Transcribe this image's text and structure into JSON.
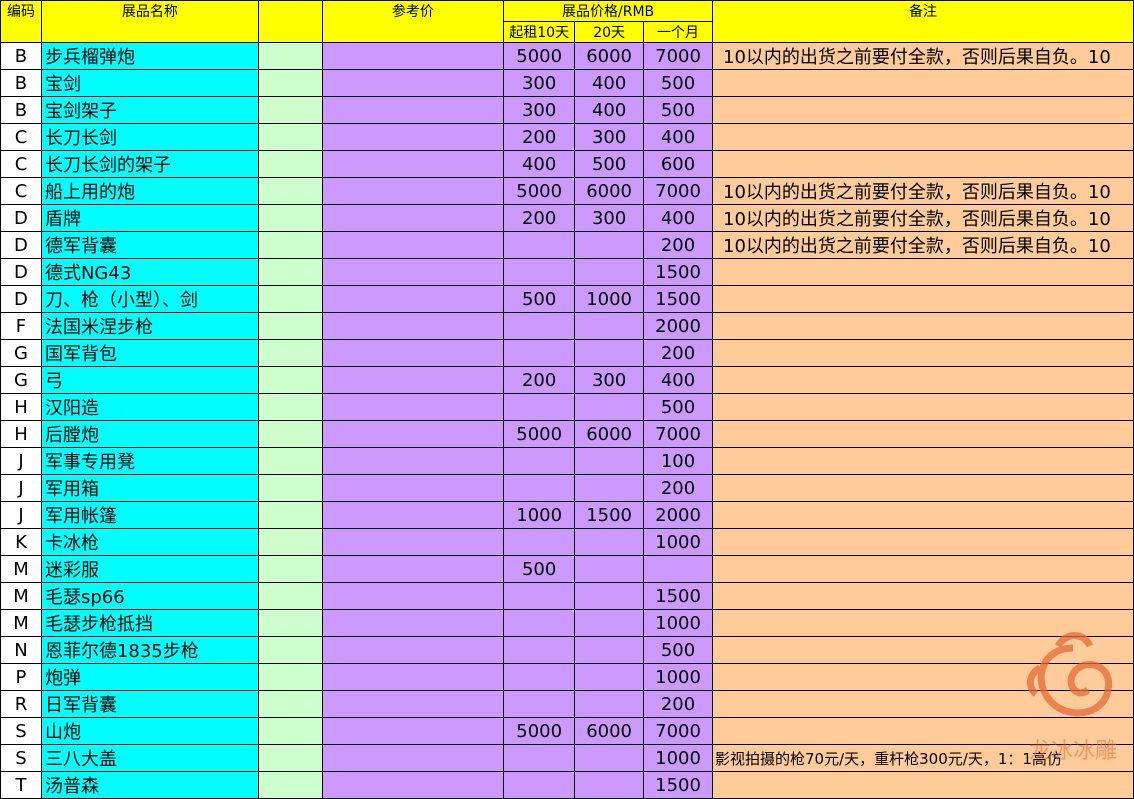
{
  "headers": {
    "code": "编码",
    "name": "展品名称",
    "ref_price": "参考价",
    "price_group": "展品价格/RMB",
    "p10": "起租10天",
    "p20": "20天",
    "pmonth": "一个月",
    "note": "备注"
  },
  "rows": [
    {
      "code": "B",
      "name": "步兵榴弹炮",
      "p10": "5000",
      "p20": "6000",
      "pm": "7000",
      "note": "10以内的出货之前要付全款，否则后果自负。10"
    },
    {
      "code": "B",
      "name": "宝剑",
      "p10": "300",
      "p20": "400",
      "pm": "500",
      "note": ""
    },
    {
      "code": "B",
      "name": "宝剑架子",
      "p10": "300",
      "p20": "400",
      "pm": "500",
      "note": ""
    },
    {
      "code": "C",
      "name": "长刀长剑",
      "p10": "200",
      "p20": "300",
      "pm": "400",
      "note": ""
    },
    {
      "code": "C",
      "name": "长刀长剑的架子",
      "p10": "400",
      "p20": "500",
      "pm": "600",
      "note": ""
    },
    {
      "code": "C",
      "name": "船上用的炮",
      "p10": "5000",
      "p20": "6000",
      "pm": "7000",
      "note": "10以内的出货之前要付全款，否则后果自负。10"
    },
    {
      "code": "D",
      "name": "盾牌",
      "p10": "200",
      "p20": "300",
      "pm": "400",
      "note": "10以内的出货之前要付全款，否则后果自负。10"
    },
    {
      "code": "D",
      "name": "德军背囊",
      "p10": "",
      "p20": "",
      "pm": "200",
      "note": "10以内的出货之前要付全款，否则后果自负。10"
    },
    {
      "code": "D",
      "name": "德式NG43",
      "p10": "",
      "p20": "",
      "pm": "1500",
      "note": ""
    },
    {
      "code": "D",
      "name": "刀、枪（小型）、剑",
      "p10": "500",
      "p20": "1000",
      "pm": "1500",
      "note": ""
    },
    {
      "code": "F",
      "name": "法国米涅步枪",
      "p10": "",
      "p20": "",
      "pm": "2000",
      "note": ""
    },
    {
      "code": "G",
      "name": "国军背包",
      "p10": "",
      "p20": "",
      "pm": "200",
      "note": ""
    },
    {
      "code": "G",
      "name": "弓",
      "p10": "200",
      "p20": "300",
      "pm": "400",
      "note": ""
    },
    {
      "code": "H",
      "name": "汉阳造",
      "p10": "",
      "p20": "",
      "pm": "500",
      "note": ""
    },
    {
      "code": "H",
      "name": "后膛炮",
      "p10": "5000",
      "p20": "6000",
      "pm": "7000",
      "note": ""
    },
    {
      "code": "J",
      "name": "军事专用凳",
      "p10": "",
      "p20": "",
      "pm": "100",
      "note": ""
    },
    {
      "code": "J",
      "name": "军用箱",
      "p10": "",
      "p20": "",
      "pm": "200",
      "note": ""
    },
    {
      "code": "J",
      "name": "军用帐篷",
      "p10": "1000",
      "p20": "1500",
      "pm": "2000",
      "note": ""
    },
    {
      "code": "K",
      "name": "卡冰枪",
      "p10": "",
      "p20": "",
      "pm": "1000",
      "note": ""
    },
    {
      "code": "M",
      "name": "迷彩服",
      "p10": "500",
      "p20": "",
      "pm": "",
      "note": ""
    },
    {
      "code": "M",
      "name": "毛瑟sp66",
      "p10": "",
      "p20": "",
      "pm": "1500",
      "note": ""
    },
    {
      "code": "M",
      "name": "毛瑟步枪抵挡",
      "p10": "",
      "p20": "",
      "pm": "1000",
      "note": ""
    },
    {
      "code": "N",
      "name": "恩菲尔德1835步枪",
      "p10": "",
      "p20": "",
      "pm": "500",
      "note": ""
    },
    {
      "code": "P",
      "name": "炮弹",
      "p10": "",
      "p20": "",
      "pm": "1000",
      "note": ""
    },
    {
      "code": "R",
      "name": "日军背囊",
      "p10": "",
      "p20": "",
      "pm": "200",
      "note": ""
    },
    {
      "code": "S",
      "name": "山炮",
      "p10": "5000",
      "p20": "6000",
      "pm": "7000",
      "note": ""
    },
    {
      "code": "S",
      "name": "三八大盖",
      "p10": "",
      "p20": "",
      "pm": "1000",
      "note": "影视拍摄的枪70元/天，重杆枪300元/天，1：1高仿"
    },
    {
      "code": "T",
      "name": "汤普森",
      "p10": "",
      "p20": "",
      "pm": "1500",
      "note": ""
    }
  ],
  "watermark": {
    "text": "龙冰冰雕",
    "color": "#e86a3a"
  }
}
